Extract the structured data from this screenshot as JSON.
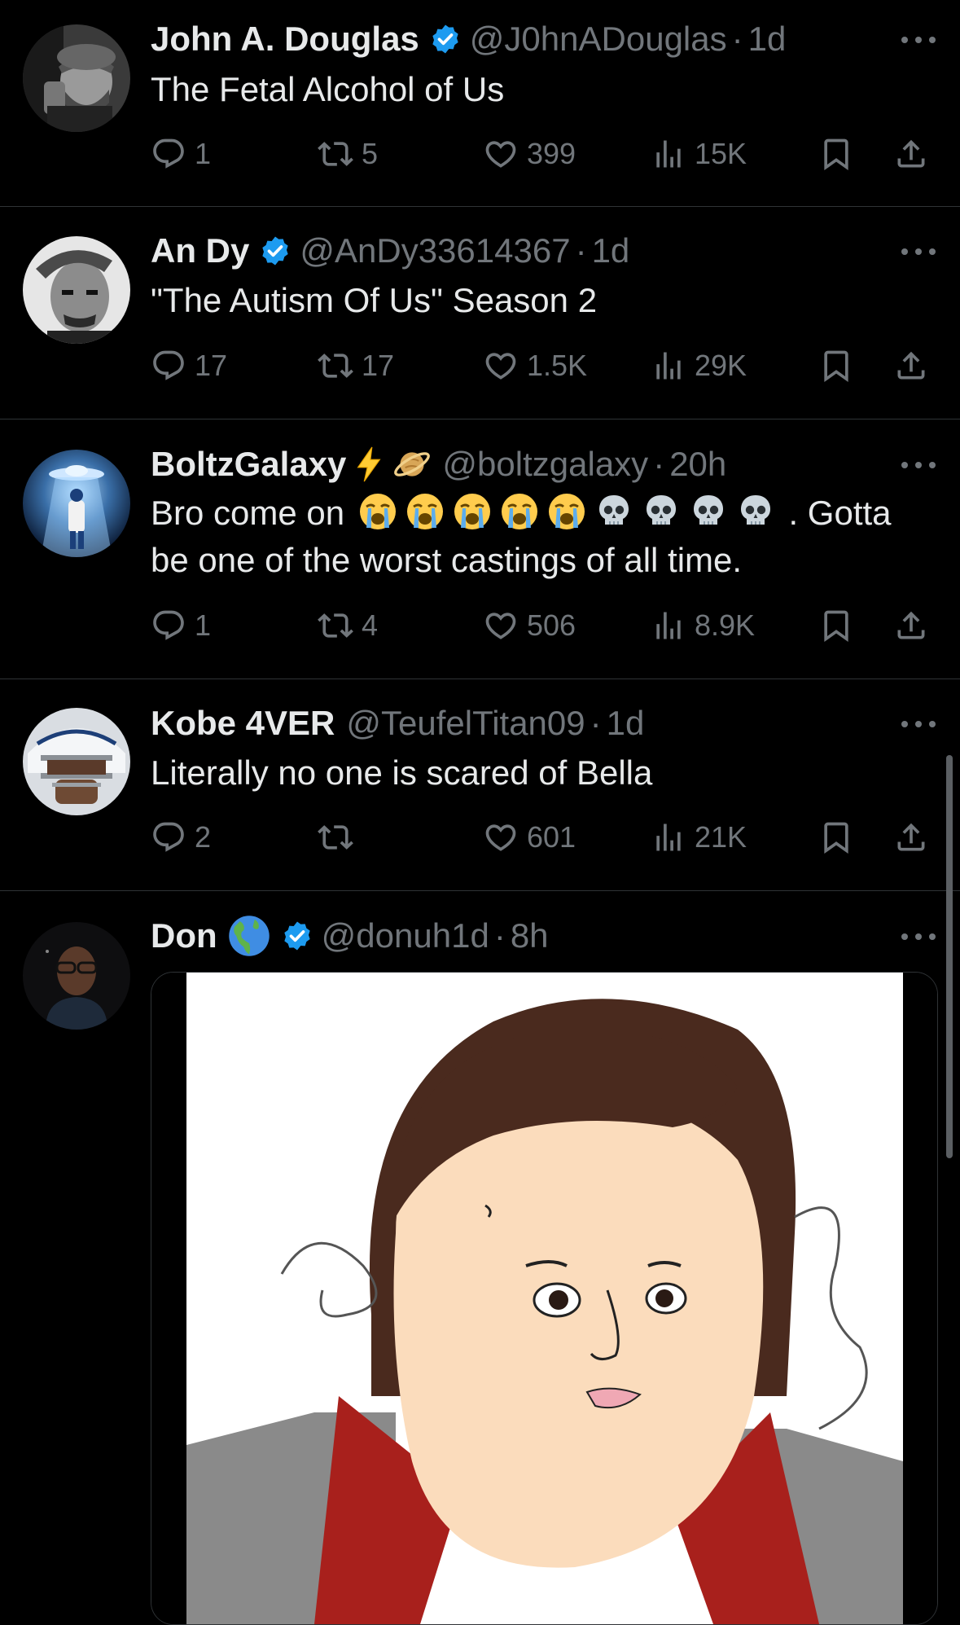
{
  "tweets": [
    {
      "name": "John A. Douglas",
      "handle": "@J0hnADouglas",
      "separator": "·",
      "time": "1d",
      "text": "The Fetal Alcohol of Us",
      "replies": "1",
      "retweets": "5",
      "likes": "399",
      "views": "15K"
    },
    {
      "name": "An Dy",
      "handle": "@AnDy33614367",
      "separator": "·",
      "time": "1d",
      "text": "\"The Autism Of Us\" Season 2",
      "replies": "17",
      "retweets": "17",
      "likes": "1.5K",
      "views": "29K"
    },
    {
      "name": "BoltzGalaxy",
      "handle": "@boltzgalaxy",
      "separator": "·",
      "time": "20h",
      "text_before": "Bro come on",
      "text_after": ". Gotta",
      "text_line2": "be one of the worst castings of all time.",
      "emoji_names": [
        "loudly-crying-face",
        "loudly-crying-face",
        "loudly-crying-face",
        "loudly-crying-face",
        "loudly-crying-face",
        "skull",
        "skull",
        "skull",
        "skull"
      ],
      "name_emojis": [
        "high-voltage",
        "ringed-planet"
      ],
      "replies": "1",
      "retweets": "4",
      "likes": "506",
      "views": "8.9K"
    },
    {
      "name": "Kobe 4VER",
      "handle": "@TeufelTitan09",
      "separator": "·",
      "time": "1d",
      "text": "Literally no one is scared of Bella",
      "replies": "2",
      "retweets": "",
      "likes": "601",
      "views": "21K"
    },
    {
      "name": "Don",
      "name_emoji": "globe-americas",
      "handle": "@donuh1d",
      "separator": "·",
      "time": "8h",
      "media": "cartoon-drawing-of-round-faced-person"
    }
  ],
  "colors": {
    "background": "#000000",
    "text": "#e7e9ea",
    "secondary": "#71767b",
    "verified": "#1d9bf0",
    "divider": "#2f3336"
  }
}
